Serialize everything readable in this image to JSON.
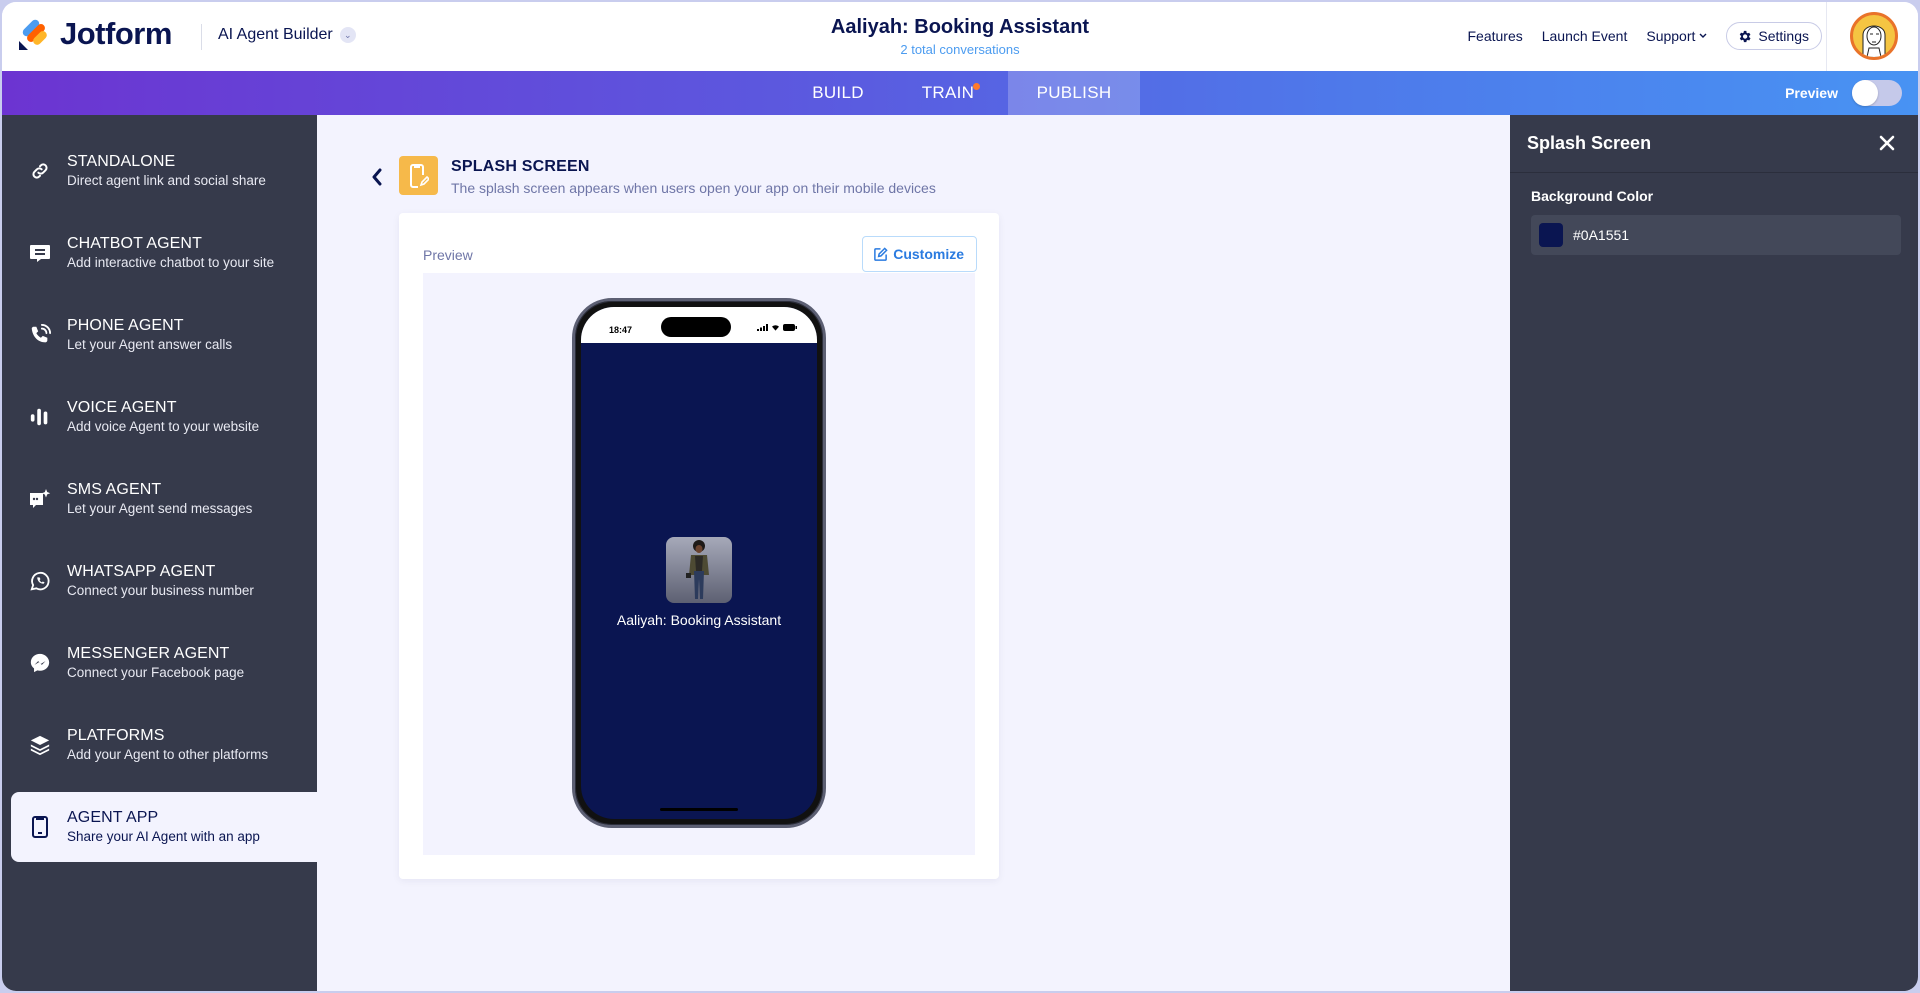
{
  "header": {
    "logo_text": "Jotform",
    "product_name": "AI Agent Builder",
    "agent_title": "Aaliyah: Booking Assistant",
    "conversations": "2 total conversations",
    "nav": {
      "features": "Features",
      "launch_event": "Launch Event",
      "support": "Support",
      "settings": "Settings"
    }
  },
  "tabs": {
    "build": "BUILD",
    "train": "TRAIN",
    "publish": "PUBLISH",
    "active": "PUBLISH",
    "train_has_notification": true
  },
  "preview_toggle": {
    "label": "Preview",
    "on": false
  },
  "sidebar": {
    "items": [
      {
        "label": "STANDALONE",
        "desc": "Direct agent link and social share",
        "icon": "link-icon"
      },
      {
        "label": "CHATBOT AGENT",
        "desc": "Add interactive chatbot to your site",
        "icon": "chat-bubble-icon"
      },
      {
        "label": "PHONE AGENT",
        "desc": "Let your Agent answer calls",
        "icon": "phone-call-icon"
      },
      {
        "label": "VOICE AGENT",
        "desc": "Add voice Agent to your website",
        "icon": "voice-bars-icon"
      },
      {
        "label": "SMS AGENT",
        "desc": "Let your Agent send messages",
        "icon": "sms-sparkle-icon"
      },
      {
        "label": "WHATSAPP AGENT",
        "desc": "Connect your business number",
        "icon": "whatsapp-icon"
      },
      {
        "label": "MESSENGER AGENT",
        "desc": "Connect your Facebook page",
        "icon": "messenger-icon"
      },
      {
        "label": "PLATFORMS",
        "desc": "Add your Agent to other platforms",
        "icon": "layers-icon"
      },
      {
        "label": "AGENT APP",
        "desc": "Share your AI Agent with an app",
        "icon": "mobile-phone-icon",
        "active": true
      }
    ]
  },
  "main": {
    "section_title": "SPLASH SCREEN",
    "section_desc": "The splash screen appears when users open your app on their mobile devices",
    "preview_label": "Preview",
    "customize_label": "Customize",
    "phone": {
      "time": "18:47",
      "agent_name": "Aaliyah: Booking Assistant",
      "background_color": "#0A1551"
    }
  },
  "panel": {
    "title": "Splash Screen",
    "background_color_label": "Background Color",
    "background_color_value": "#0A1551"
  },
  "colors": {
    "accent_blue": "#2a7be0",
    "section_icon_bg": "#f6b94a",
    "notification_dot": "#ff7a2b"
  }
}
